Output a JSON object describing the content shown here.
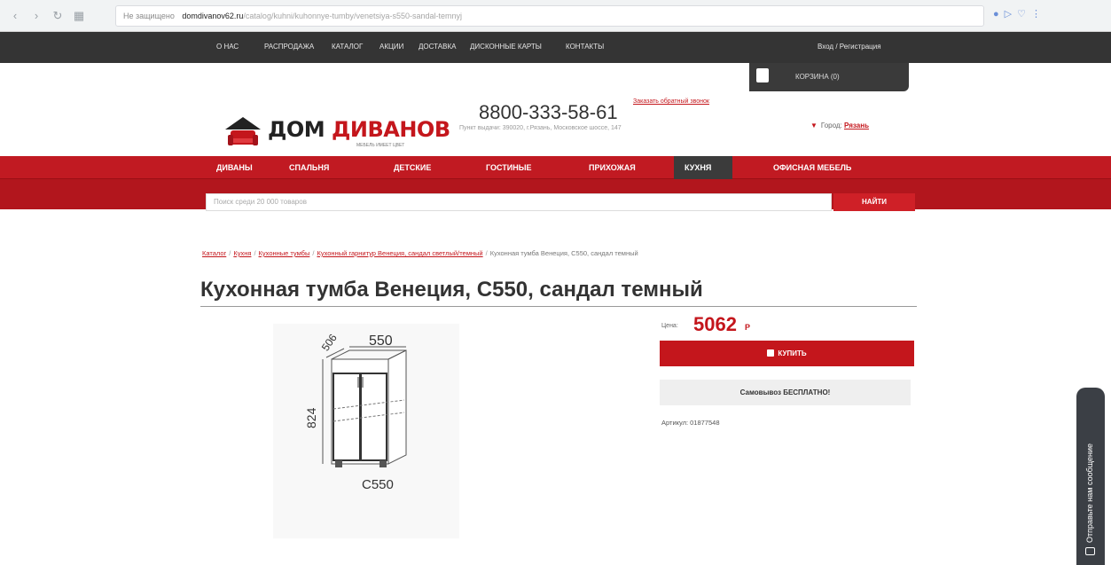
{
  "browser": {
    "insecure_label": "Не защищено",
    "domain": "domdivanov62.ru",
    "path": "/catalog/kuhni/kuhonnye-tumby/venetsiya-s550-sandal-temnyj"
  },
  "topnav": {
    "items": [
      "О НАС",
      "РАСПРОДАЖА",
      "КАТАЛОГ",
      "АКЦИИ",
      "ДОСТАВКА",
      "ДИСКОННЫЕ КАРТЫ",
      "КОНТАКТЫ"
    ],
    "auth": "Вход / Регистрация"
  },
  "cart": {
    "label": "КОРЗИНА (0)"
  },
  "header": {
    "logo_part1": "ДОМ ",
    "logo_part2": "ДИВАНОВ",
    "logo_tagline": "МЕБЕЛЬ ИМЕЕТ ЦВЕТ",
    "phone": "8800-333-58-61",
    "callback": "Заказать обратный звонок",
    "pickup": "Пункт выдачи: 390020, г.Рязань, Московское шоссе, 147",
    "city_label": "Город:",
    "city_name": "Рязань"
  },
  "categories": {
    "items": [
      "ДИВАНЫ",
      "СПАЛЬНЯ",
      "ДЕТСКИЕ",
      "ГОСТИНЫЕ",
      "ПРИХОЖАЯ",
      "КУХНЯ",
      "ОФИСНАЯ МЕБЕЛЬ"
    ],
    "active": "КУХНЯ"
  },
  "search": {
    "placeholder": "Поиск среди 20 000 товаров",
    "button": "НАЙТИ"
  },
  "breadcrumbs": {
    "items": [
      "Каталог",
      "Кухня",
      "Кухонные тумбы",
      "Кухонный гарнитур Венеция, сандал светлый/темный"
    ],
    "current": "Кухонная тумба Венеция, С550, сандал темный"
  },
  "product": {
    "title": "Кухонная тумба Венеция, С550, сандал темный",
    "price_label": "Цена:",
    "price": "5062",
    "currency": "Р",
    "buy": "КУПИТЬ",
    "pickup_free": "Самовывоз БЕСПЛАТНО!",
    "article": "Артикул: 01877548",
    "dim_width": "550",
    "dim_depth": "506",
    "dim_height": "824",
    "model": "C550"
  },
  "chat": {
    "label": "Отправьте нам сообщение"
  },
  "colors": {
    "brand_red": "#c4161c",
    "dark_nav": "#343434"
  }
}
